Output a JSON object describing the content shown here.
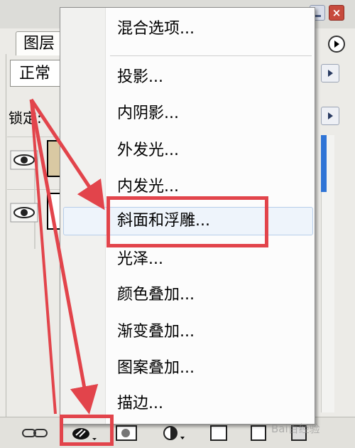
{
  "panel": {
    "tab_label": "图层",
    "blend_mode": "正常",
    "lock_label": "锁定:"
  },
  "menu": {
    "items": [
      {
        "label": "混合选项..."
      },
      {
        "label": "投影..."
      },
      {
        "label": "内阴影..."
      },
      {
        "label": "外发光..."
      },
      {
        "label": "内发光..."
      },
      {
        "label": "斜面和浮雕..."
      },
      {
        "label": "光泽..."
      },
      {
        "label": "颜色叠加..."
      },
      {
        "label": "渐变叠加..."
      },
      {
        "label": "图案叠加..."
      },
      {
        "label": "描边..."
      }
    ]
  },
  "annotations": {
    "highlight_color": "#e2444b"
  },
  "watermark": "Bai百经验"
}
